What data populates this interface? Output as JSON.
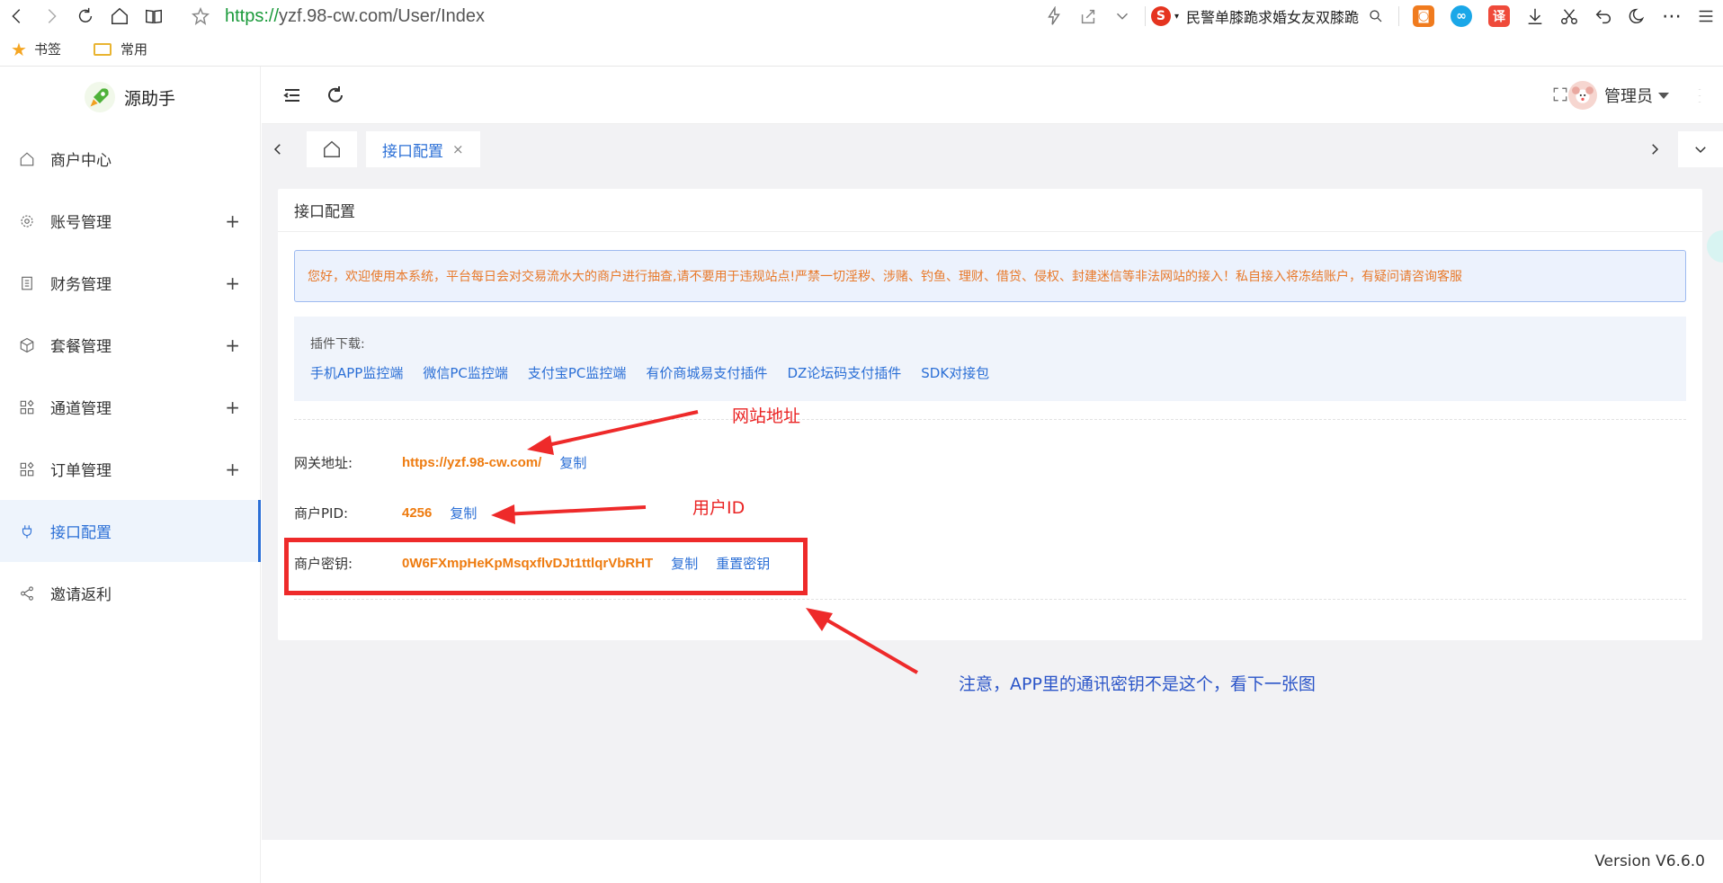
{
  "browser": {
    "url_scheme": "https://",
    "url_rest": "yzf.98-cw.com/User/Index",
    "search_text": "民警单膝跪求婚女友双膝跪",
    "search_engine_glyph": "S",
    "translate_glyph": "译"
  },
  "bookmarks": [
    {
      "label": "书签",
      "icon": "star-icon"
    },
    {
      "label": "常用",
      "icon": "folder-icon"
    }
  ],
  "sidebar": {
    "brand": "源助手",
    "items": [
      {
        "label": "商户中心",
        "icon": "home-icon",
        "expandable": false
      },
      {
        "label": "账号管理",
        "icon": "gear-icon",
        "expandable": true
      },
      {
        "label": "财务管理",
        "icon": "ledger-icon",
        "expandable": true
      },
      {
        "label": "套餐管理",
        "icon": "box-icon",
        "expandable": true
      },
      {
        "label": "通道管理",
        "icon": "grid-icon",
        "expandable": true
      },
      {
        "label": "订单管理",
        "icon": "grid-icon",
        "expandable": true
      },
      {
        "label": "接口配置",
        "icon": "plug-icon",
        "expandable": false,
        "active": true
      },
      {
        "label": "邀请返利",
        "icon": "share-icon",
        "expandable": false
      }
    ],
    "plus": "+"
  },
  "header": {
    "admin_name": "管理员"
  },
  "tabs": {
    "active_label": "接口配置",
    "close": "×"
  },
  "card": {
    "title": "接口配置",
    "notice": "您好，欢迎使用本系统，平台每日会对交易流水大的商户进行抽查,请不要用于违规站点!严禁一切淫秽、涉赌、钓鱼、理财、借贷、侵权、封建迷信等非法网站的接入！私自接入将冻结账户，有疑问请咨询客服",
    "plugins_label": "插件下载:",
    "plugin_links": [
      "手机APP监控端",
      "微信PC监控端",
      "支付宝PC监控端",
      "有价商城易支付插件",
      "DZ论坛码支付插件",
      "SDK对接包"
    ],
    "gateway": {
      "label": "网关地址:",
      "value": "https://yzf.98-cw.com/",
      "copy": "复制"
    },
    "pid": {
      "label": "商户PID:",
      "value": "4256",
      "copy": "复制"
    },
    "secret": {
      "label": "商户密钥:",
      "value": "0W6FXmpHeKpMsqxflvDJt1ttlqrVbRHT",
      "copy": "复制",
      "reset": "重置密钥"
    }
  },
  "annotations": {
    "site_address": "网站地址",
    "user_id": "用户ID",
    "note": "注意，APP里的通讯密钥不是这个，看下一张图"
  },
  "footer": {
    "version": "Version V6.6.0"
  },
  "colors": {
    "accent": "#2b6fd6",
    "orange": "#ee7b0f",
    "annotation_red": "#ea2424"
  }
}
